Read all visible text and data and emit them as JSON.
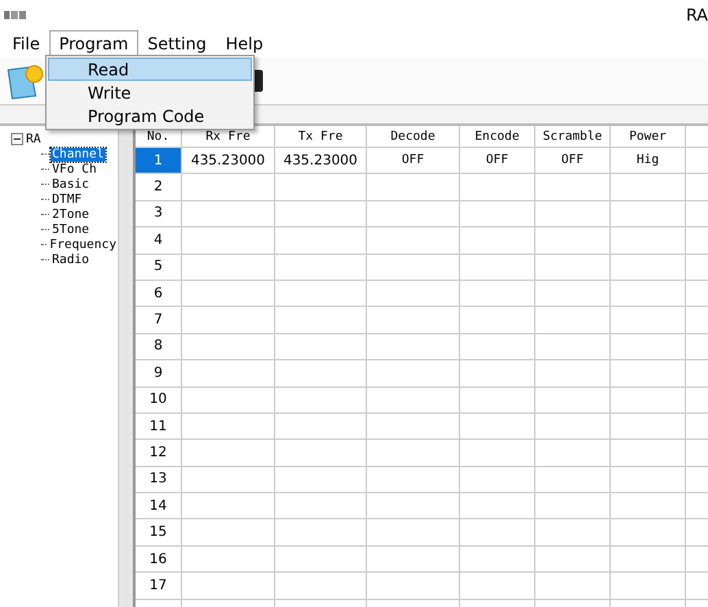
{
  "window": {
    "title": "RA"
  },
  "menu_bar": [
    {
      "label": "File",
      "selected": false
    },
    {
      "label": "Program",
      "selected": true
    },
    {
      "label": "Setting",
      "selected": false
    },
    {
      "label": "Help",
      "selected": false
    }
  ],
  "dropdown": [
    {
      "label": "Read",
      "selected": true
    },
    {
      "label": "Write",
      "selected": false
    },
    {
      "label": "Program Code",
      "selected": false
    }
  ],
  "tree": {
    "label": "RA",
    "expanded": true,
    "children": [
      {
        "label": "Channel",
        "selected": true
      },
      {
        "label": "VFo  Ch",
        "selected": false
      },
      {
        "label": "Basic",
        "selected": false
      },
      {
        "label": "DTMF",
        "selected": false
      },
      {
        "label": "2Tone",
        "selected": false
      },
      {
        "label": "5Tone",
        "selected": false
      },
      {
        "label": "Frequency",
        "selected": false
      },
      {
        "label": "Radio",
        "selected": false
      }
    ]
  },
  "table": {
    "columns": [
      "No.",
      "Rx Fre",
      "Tx Fre",
      "Decode",
      "Encode",
      "Scramble",
      "Power"
    ],
    "rows": [
      {
        "cells": [
          "1",
          "435.23000",
          "435.23000",
          "OFF",
          "OFF",
          "OFF",
          "Hig"
        ],
        "selected": true
      },
      {
        "cells": [
          "2"
        ],
        "selected": false
      },
      {
        "cells": [
          "3"
        ],
        "selected": false
      },
      {
        "cells": [
          "4"
        ],
        "selected": false
      },
      {
        "cells": [
          "5"
        ],
        "selected": false
      },
      {
        "cells": [
          "6"
        ],
        "selected": false
      },
      {
        "cells": [
          "7"
        ],
        "selected": false
      },
      {
        "cells": [
          "8"
        ],
        "selected": false
      },
      {
        "cells": [
          "9"
        ],
        "selected": false
      },
      {
        "cells": [
          "10"
        ],
        "selected": false
      },
      {
        "cells": [
          "11"
        ],
        "selected": false
      },
      {
        "cells": [
          "12"
        ],
        "selected": false
      },
      {
        "cells": [
          "13"
        ],
        "selected": false
      },
      {
        "cells": [
          "14"
        ],
        "selected": false
      },
      {
        "cells": [
          "15"
        ],
        "selected": false
      },
      {
        "cells": [
          "16"
        ],
        "selected": false
      },
      {
        "cells": [
          "17"
        ],
        "selected": false
      }
    ]
  }
}
